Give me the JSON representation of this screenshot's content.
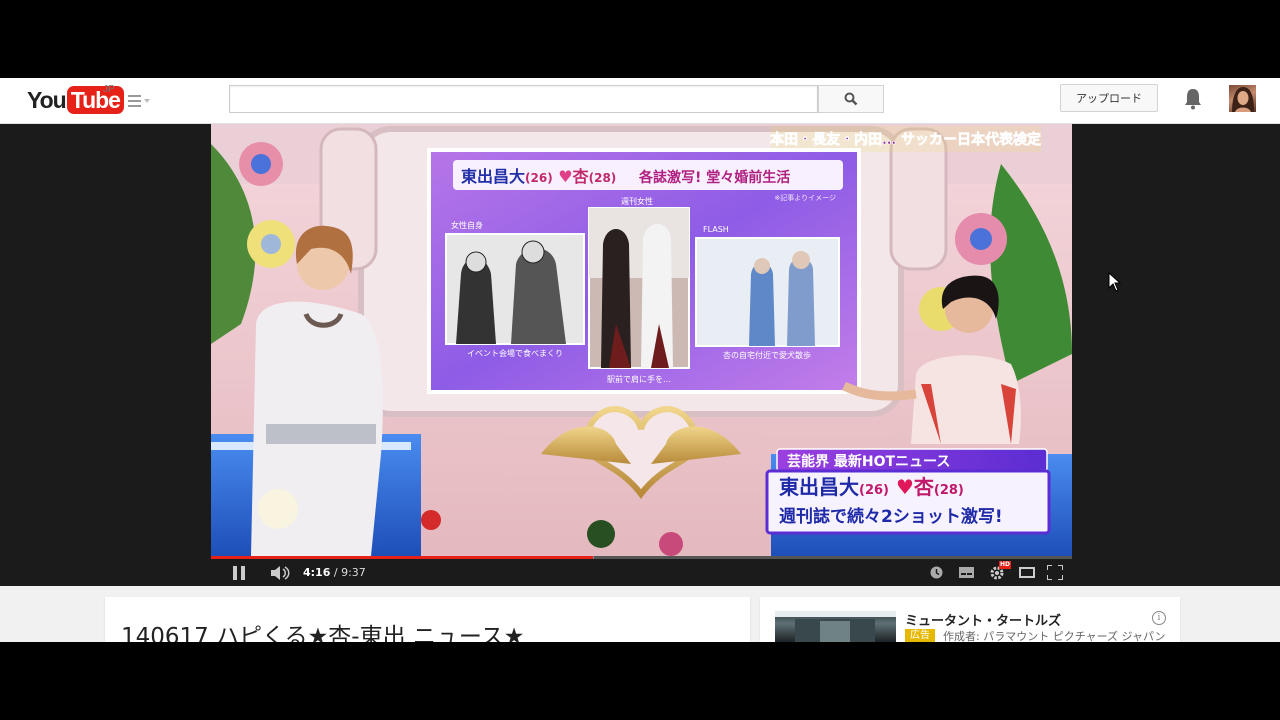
{
  "masthead": {
    "logo_you": "You",
    "logo_tube": "Tube",
    "logo_region": "JP",
    "search_placeholder": "",
    "upload_label": "アップロード"
  },
  "video": {
    "top_ticker": "本田・長友・内田… サッカー日本代表検定",
    "board_headline_name": "東出昌大",
    "board_headline_age1": "(26)",
    "board_headline_name2": "杏",
    "board_headline_age2": "(28)",
    "board_headline_rest": "各誌激写! 堂々婚前生活",
    "board_note": "※記事よりイメージ",
    "panels": [
      {
        "tag": "女性自身",
        "caption": "イベント会場で食べまくり"
      },
      {
        "tag": "週刊女性",
        "caption": "駅前で肩に手を…"
      },
      {
        "tag": "FLASH",
        "caption": "杏の自宅付近で愛犬散歩"
      }
    ],
    "lower_third_label": "芸能界 最新HOTニュース",
    "lower_third_name1": "東出昌大",
    "lower_third_age1": "(26)",
    "lower_third_name2": "杏",
    "lower_third_age2": "(28)",
    "lower_third_line2": "週刊誌で続々2ショット激写!"
  },
  "player": {
    "current_time": "4:16",
    "separator": " / ",
    "duration": "9:37",
    "progress_fraction": 0.444,
    "buffered_fraction": 0.445,
    "hd_badge": "HD"
  },
  "watch": {
    "title": "140617 ハピくる★杏-東出 ニュース★"
  },
  "sidebar_ad": {
    "title": "ミュータント・タートルズ",
    "badge": "広告",
    "author": "作成者: パラマウント ピクチャーズ ジャパン"
  },
  "colors": {
    "brand_red": "#e62117",
    "ad_badge": "#e6b800"
  }
}
